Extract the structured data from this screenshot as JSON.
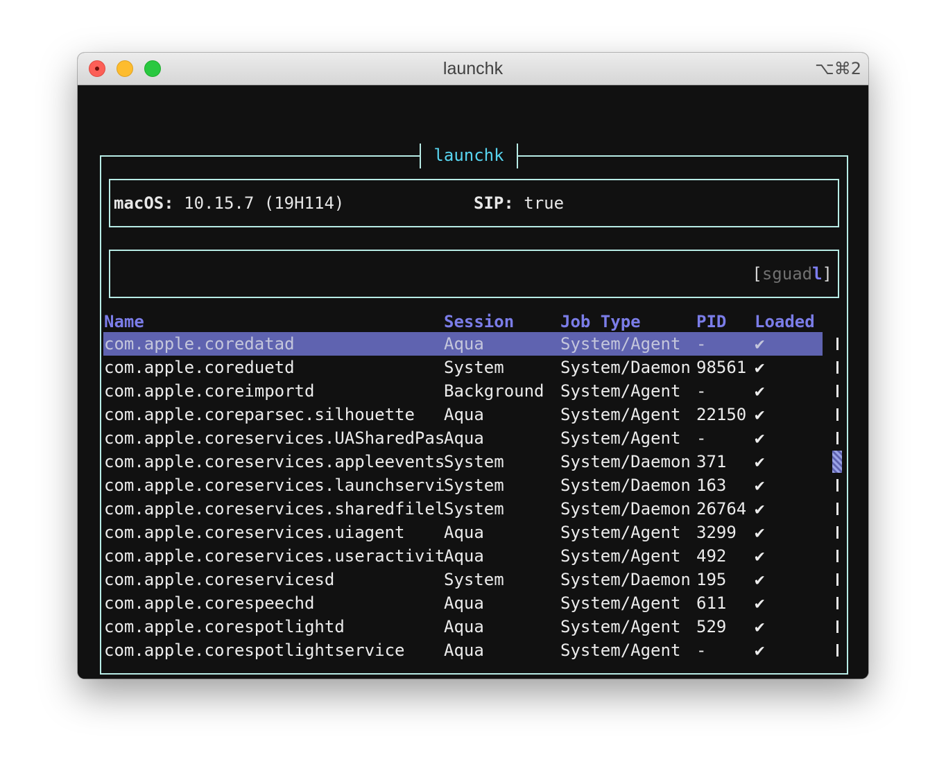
{
  "window": {
    "title": "launchk",
    "shortcut": "⌥⌘2"
  },
  "frame_title": "launchk",
  "info": {
    "macos_label": "macOS:",
    "macos_value": "10.15.7 (19H114)",
    "sip_label": "SIP:",
    "sip_value": "true"
  },
  "filter": {
    "open_bracket": "[",
    "dim_text": "sguad",
    "active_char": "l",
    "close_bracket": "]"
  },
  "headers": {
    "name": "Name",
    "session": "Session",
    "job_type": "Job Type",
    "pid": "PID",
    "loaded": "Loaded"
  },
  "rows": [
    {
      "name": "com.apple.coredatad",
      "session": "Aqua",
      "job_type": "System/Agent",
      "pid": "-",
      "loaded": "✔"
    },
    {
      "name": "com.apple.coreduetd",
      "session": "System",
      "job_type": "System/Daemon",
      "pid": "98561",
      "loaded": "✔"
    },
    {
      "name": "com.apple.coreimportd",
      "session": "Background",
      "job_type": "System/Agent",
      "pid": "-",
      "loaded": "✔"
    },
    {
      "name": "com.apple.coreparsec.silhouette",
      "session": "Aqua",
      "job_type": "System/Agent",
      "pid": "22150",
      "loaded": "✔"
    },
    {
      "name": "com.apple.coreservices.UASharedPas",
      "session": "Aqua",
      "job_type": "System/Agent",
      "pid": "-",
      "loaded": "✔"
    },
    {
      "name": "com.apple.coreservices.appleevents",
      "session": "System",
      "job_type": "System/Daemon",
      "pid": "371",
      "loaded": "✔"
    },
    {
      "name": "com.apple.coreservices.launchservi",
      "session": "System",
      "job_type": "System/Daemon",
      "pid": "163",
      "loaded": "✔"
    },
    {
      "name": "com.apple.coreservices.sharedfilel",
      "session": "System",
      "job_type": "System/Daemon",
      "pid": "26764",
      "loaded": "✔"
    },
    {
      "name": "com.apple.coreservices.uiagent",
      "session": "Aqua",
      "job_type": "System/Agent",
      "pid": "3299",
      "loaded": "✔"
    },
    {
      "name": "com.apple.coreservices.useractivit",
      "session": "Aqua",
      "job_type": "System/Agent",
      "pid": "492",
      "loaded": "✔"
    },
    {
      "name": "com.apple.coreservicesd",
      "session": "System",
      "job_type": "System/Daemon",
      "pid": "195",
      "loaded": "✔"
    },
    {
      "name": "com.apple.corespeechd",
      "session": "Aqua",
      "job_type": "System/Agent",
      "pid": "611",
      "loaded": "✔"
    },
    {
      "name": "com.apple.corespotlightd",
      "session": "Aqua",
      "job_type": "System/Agent",
      "pid": "529",
      "loaded": "✔"
    },
    {
      "name": "com.apple.corespotlightservice",
      "session": "Aqua",
      "job_type": "System/Agent",
      "pid": "-",
      "loaded": "✔"
    }
  ],
  "selected_row_index": 0,
  "colors": {
    "accent": "#7b7de8",
    "selection": "#5f63b0",
    "border": "#b8ece6",
    "title_cyan": "#58d5f0",
    "background": "#111111"
  }
}
